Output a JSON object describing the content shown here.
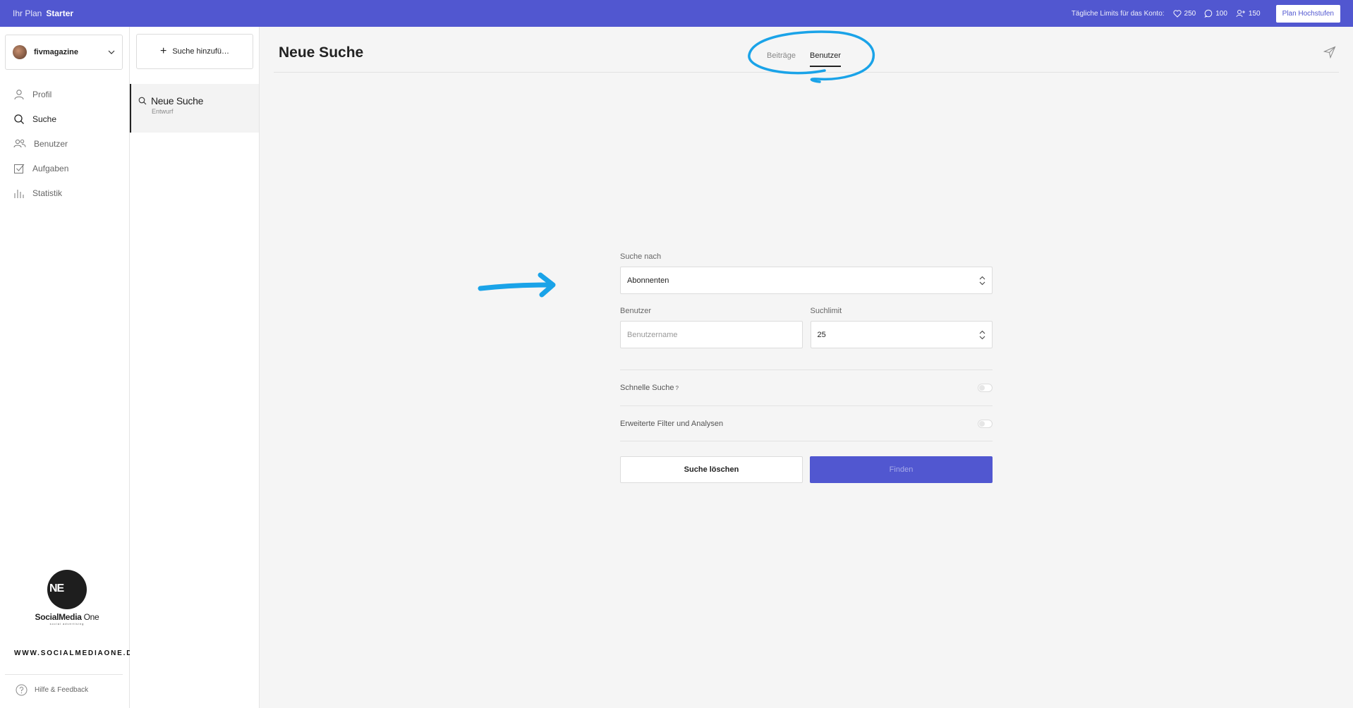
{
  "topbar": {
    "plan_prefix": "Ihr Plan",
    "plan_name": "Starter",
    "limits_label": "Tägliche Limits für das Konto:",
    "likes": "250",
    "comments": "100",
    "follows": "150",
    "upgrade_label": "Plan Hochstufen"
  },
  "account": {
    "name": "fivmagazine"
  },
  "nav": {
    "profile": "Profil",
    "search": "Suche",
    "users": "Benutzer",
    "tasks": "Aufgaben",
    "statistics": "Statistik"
  },
  "brand": {
    "initials": "NE",
    "name_bold": "SocialMedia",
    "name_light": " One",
    "tagline": "social advertising",
    "website": "WWW.SOCIALMEDIAONE.DE"
  },
  "help_label": "Hilfe & Feedback",
  "searches": {
    "add_label": "Suche hinzufü…",
    "items": [
      {
        "title": "Neue Suche",
        "status": "Entwurf"
      }
    ]
  },
  "main": {
    "title": "Neue Suche",
    "tabs": [
      {
        "label": "Beiträge"
      },
      {
        "label": "Benutzer",
        "active": true
      }
    ]
  },
  "form": {
    "search_by_label": "Suche nach",
    "search_by_value": "Abonnenten",
    "user_label": "Benutzer",
    "user_placeholder": "Benutzername",
    "limit_label": "Suchlimit",
    "limit_value": "25",
    "quick_search_label": "Schnelle Suche",
    "quick_search_hint": "?",
    "advanced_label": "Erweiterte Filter und Analysen",
    "clear_label": "Suche löschen",
    "find_label": "Finden"
  },
  "colors": {
    "accent": "#5157d0",
    "annotation": "#1aa3e8"
  }
}
